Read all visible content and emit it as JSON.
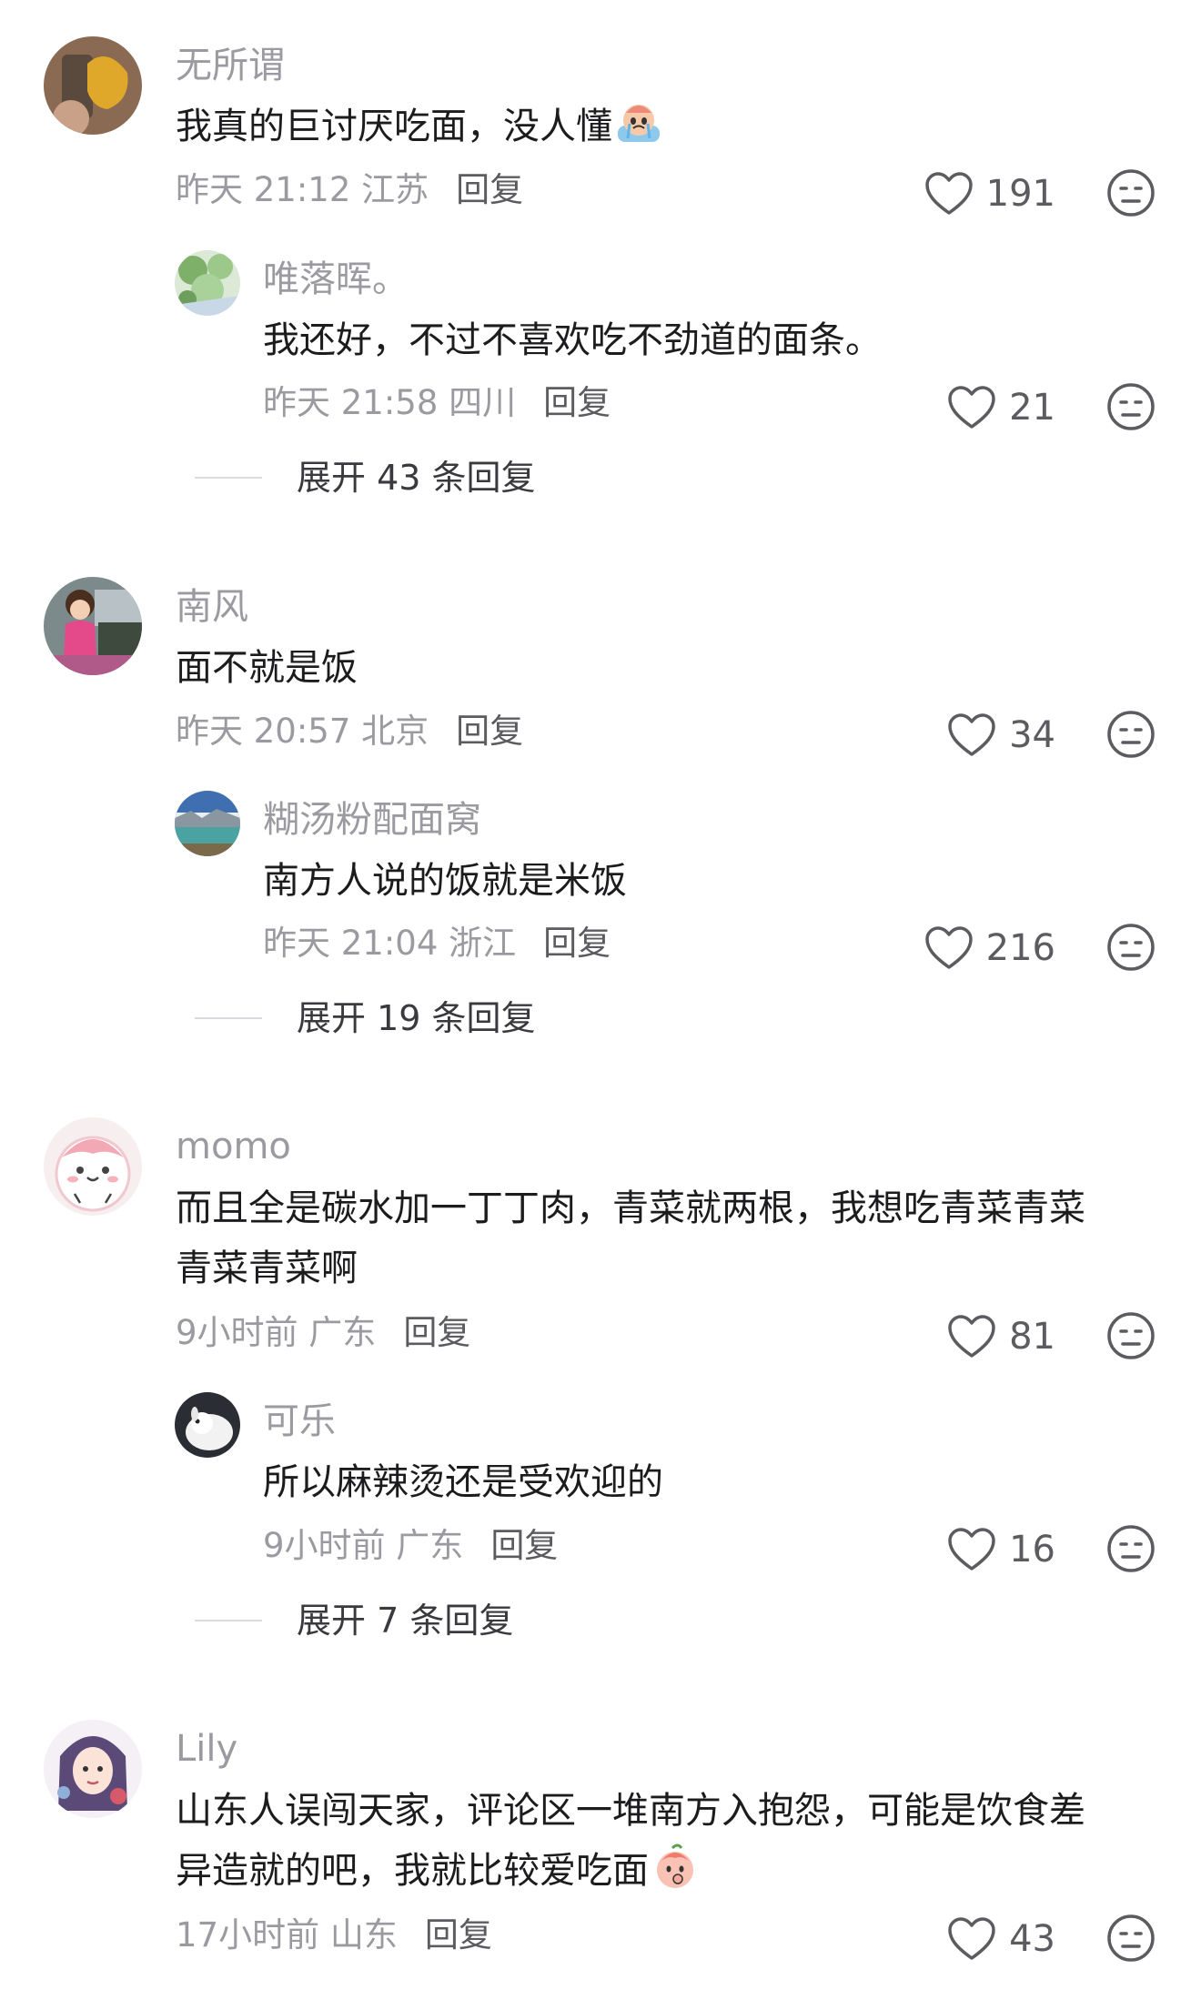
{
  "comments": [
    {
      "user": "无所谓",
      "text": "我真的巨讨厌吃面，没人懂",
      "emoji": "crying-emoji",
      "time": "昨天 21:12 江苏",
      "reply_label": "回复",
      "likes": "191",
      "reply": {
        "user": "唯落晖。",
        "text": "我还好，不过不喜欢吃不劲道的面条。",
        "time": "昨天 21:58 四川",
        "reply_label": "回复",
        "likes": "21"
      },
      "expand": "展开 43 条回复"
    },
    {
      "user": "南风",
      "text": "面不就是饭",
      "time": "昨天 20:57 北京",
      "reply_label": "回复",
      "likes": "34",
      "reply": {
        "user": "糊汤粉配面窝",
        "text": "南方人说的饭就是米饭",
        "time": "昨天 21:04 浙江",
        "reply_label": "回复",
        "likes": "216"
      },
      "expand": "展开 19 条回复"
    },
    {
      "user": "momo",
      "text_line1": "而且全是碳水加一丁丁肉，青菜就两根，我想吃青菜青菜",
      "text_line2": "青菜青菜啊",
      "time": "9小时前 广东",
      "reply_label": "回复",
      "likes": "81",
      "reply": {
        "user": "可乐",
        "text": "所以麻辣烫还是受欢迎的",
        "time": "9小时前 广东",
        "reply_label": "回复",
        "likes": "16"
      },
      "expand": "展开 7 条回复"
    },
    {
      "user": "Lily",
      "text_line1": "山东人误闯天家，评论区一堆南方入抱怨，可能是饮食差",
      "text_line2": "异造就的吧，我就比较爱吃面",
      "emoji": "thinking-emoji",
      "time": "17小时前 山东",
      "reply_label": "回复",
      "likes": "43"
    }
  ],
  "colors": {
    "secondary_text": "#9a9aa0",
    "primary_text": "#1c1c1e",
    "icon": "#5b5b60"
  }
}
